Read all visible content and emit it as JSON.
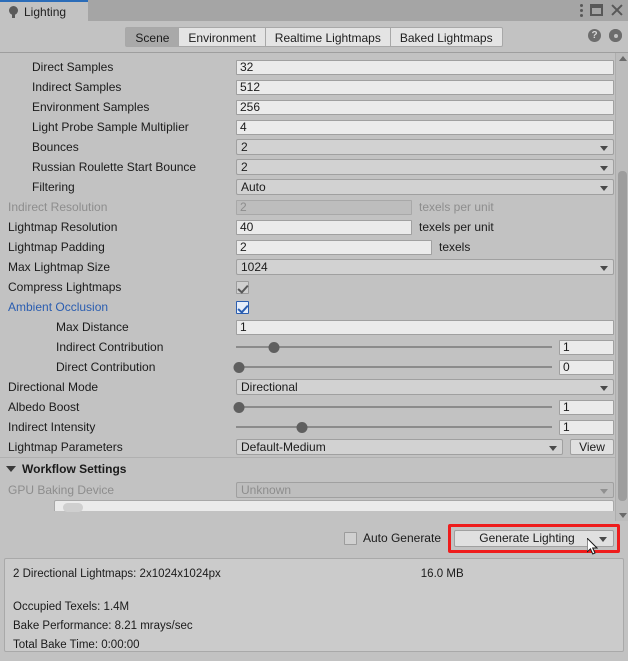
{
  "window": {
    "tab_label": "Lighting",
    "tab_icon": "light-bulb-icon",
    "kebab_icon": "more-options-icon",
    "maximize_icon": "maximize-icon",
    "close_icon": "close-icon"
  },
  "toolbar": {
    "tabs": [
      {
        "label": "Scene",
        "selected": true
      },
      {
        "label": "Environment",
        "selected": false
      },
      {
        "label": "Realtime Lightmaps",
        "selected": false
      },
      {
        "label": "Baked Lightmaps",
        "selected": false
      }
    ],
    "help_icon": "?",
    "settings_icon": "gear-icon"
  },
  "properties": [
    {
      "label": "Direct Samples",
      "value": "32"
    },
    {
      "label": "Indirect Samples",
      "value": "512"
    },
    {
      "label": "Environment Samples",
      "value": "256"
    },
    {
      "label": "Light Probe Sample Multiplier",
      "value": "4"
    },
    {
      "label": "Bounces",
      "value": "2"
    },
    {
      "label": "Russian Roulette Start Bounce",
      "value": "2"
    },
    {
      "label": "Filtering",
      "value": "Auto"
    },
    {
      "label": "Indirect Resolution",
      "value": "2",
      "units": "texels per unit"
    },
    {
      "label": "Lightmap Resolution",
      "value": "40",
      "units": "texels per unit"
    },
    {
      "label": "Lightmap Padding",
      "value": "2",
      "units": "texels"
    },
    {
      "label": "Max Lightmap Size",
      "value": "1024"
    },
    {
      "label": "Compress Lightmaps"
    },
    {
      "label": "Ambient Occlusion"
    },
    {
      "label": "Max Distance",
      "value": "1"
    },
    {
      "label": "Indirect Contribution",
      "value": "1"
    },
    {
      "label": "Direct Contribution",
      "value": "0"
    },
    {
      "label": "Directional Mode",
      "value": "Directional"
    },
    {
      "label": "Albedo Boost",
      "value": "1"
    },
    {
      "label": "Indirect Intensity",
      "value": "1"
    },
    {
      "label": "Lightmap Parameters",
      "value": "Default-Medium",
      "button": "View"
    }
  ],
  "workflow": {
    "section_label": "Workflow Settings",
    "gpu_label": "GPU Baking Device",
    "gpu_value": "Unknown"
  },
  "actions": {
    "auto_generate_label": "Auto Generate",
    "generate_label": "Generate Lighting",
    "highlight_color": "#ee1c1c"
  },
  "status": {
    "lightmaps_line": "2 Directional Lightmaps: 2x1024x1024px",
    "size": "16.0 MB",
    "occupied_texels": "Occupied Texels: 1.4M",
    "bake_performance": "Bake Performance: 8.21 mrays/sec",
    "total_bake_time": "Total Bake Time: 0:00:00"
  }
}
